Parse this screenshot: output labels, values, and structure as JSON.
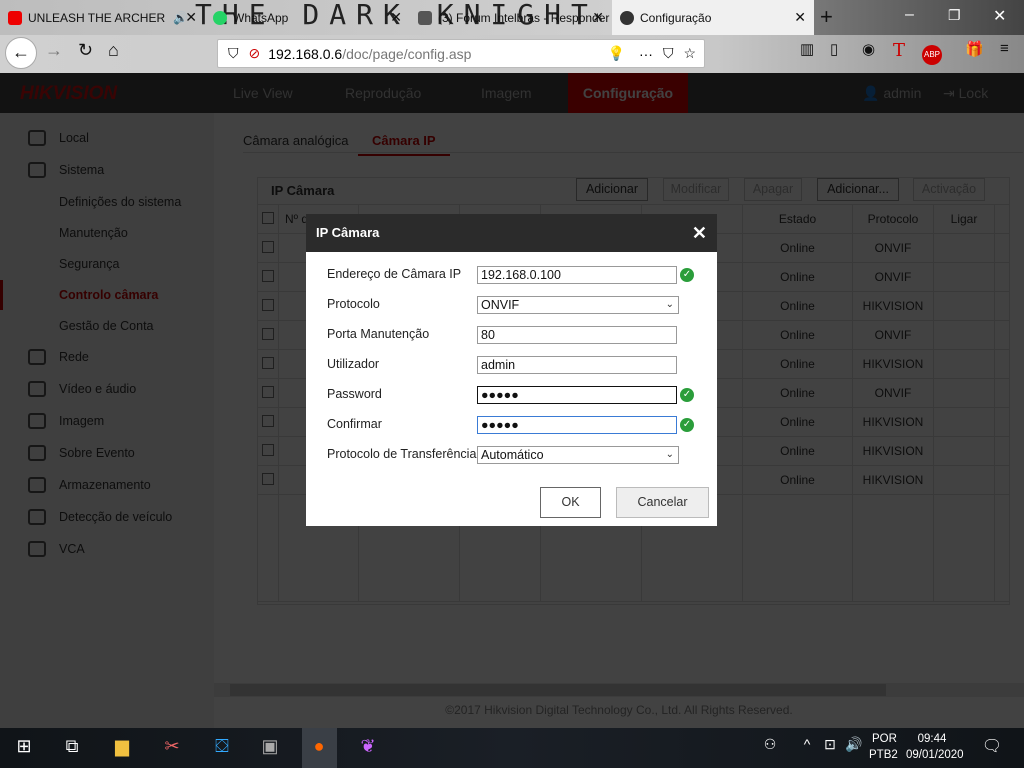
{
  "browser": {
    "tabs": [
      {
        "title": "UNLEASH THE ARCHER",
        "icon": "youtube-icon"
      },
      {
        "title": "WhatsApp",
        "icon": "whatsapp-icon"
      },
      {
        "title": "(3) Fórum Intelbras - Responder",
        "icon": "forum-icon"
      },
      {
        "title": "Configuração",
        "icon": "camera-icon",
        "active": true
      }
    ],
    "theme_text": "THE DARK KNIGHT",
    "url_host": "192.168.0.6",
    "url_path": "/doc/page/config.asp"
  },
  "app": {
    "logo": "HIKVISION",
    "menu": [
      "Live View",
      "Reprodução",
      "Imagem",
      "Configuração"
    ],
    "active_menu": "Configuração",
    "user": "admin",
    "lock": "Lock",
    "accent": "#c00000"
  },
  "sidebar": {
    "items": [
      "Local",
      "Sistema",
      "Definições do sistema",
      "Manutenção",
      "Segurança",
      "Controlo câmara",
      "Gestão de Conta",
      "Rede",
      "Vídeo e áudio",
      "Imagem",
      "Sobre Evento",
      "Armazenamento",
      "Detecção de veículo",
      "VCA"
    ],
    "selected": "Controlo câmara"
  },
  "main": {
    "tabs": [
      "Câmara analógica",
      "Câmara IP"
    ],
    "active_tab": "Câmara IP",
    "section_title": "IP Câmara",
    "buttons": [
      "Adicionar",
      "Modificar",
      "Apagar",
      "Adicionar...",
      "Activação"
    ],
    "columns": [
      "Nº d",
      "",
      "",
      "",
      "a",
      "Estado",
      "Protocolo",
      "Ligar"
    ],
    "rows": [
      [
        "Online",
        "ONVIF"
      ],
      [
        "Online",
        "ONVIF"
      ],
      [
        "Online",
        "HIKVISION"
      ],
      [
        "Online",
        "ONVIF"
      ],
      [
        "Online",
        "HIKVISION"
      ],
      [
        "Online",
        "ONVIF"
      ],
      [
        "Online",
        "HIKVISION"
      ],
      [
        "Online",
        "HIKVISION"
      ],
      [
        "Online",
        "HIKVISION"
      ]
    ],
    "footer": "©2017 Hikvision Digital Technology Co., Ltd. All Rights Reserved."
  },
  "dialog": {
    "title": "IP Câmara",
    "fields": [
      {
        "label": "Endereço de Câmara IP",
        "value": "192.168.0.100",
        "valid": true
      },
      {
        "label": "Protocolo",
        "value": "ONVIF"
      },
      {
        "label": "Porta Manutenção",
        "value": "80"
      },
      {
        "label": "Utilizador",
        "value": "admin"
      },
      {
        "label": "Password",
        "value": "●●●●●",
        "valid": true
      },
      {
        "label": "Confirmar",
        "value": "●●●●●",
        "valid": true
      },
      {
        "label": "Protocolo de Transferência",
        "value": "Automático"
      }
    ],
    "ok": "OK",
    "cancel": "Cancelar"
  },
  "taskbar": {
    "lang1": "POR",
    "lang2": "PTB2",
    "time": "09:44",
    "date": "09/01/2020"
  }
}
